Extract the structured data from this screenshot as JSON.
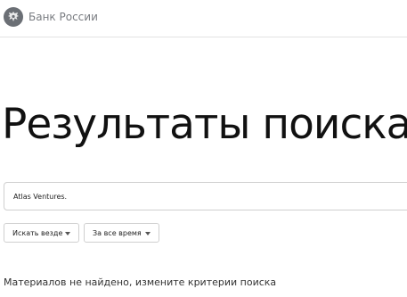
{
  "header": {
    "brand_name": "Банк России",
    "logo_icon": "double-headed-eagle-icon"
  },
  "main": {
    "title": "Результаты поиска",
    "search": {
      "value": "Atlas Ventures."
    },
    "filters": [
      {
        "label": "Искать везде",
        "icon": "chevron-down-icon"
      },
      {
        "label": "За все время",
        "icon": "chevron-down-icon"
      }
    ],
    "message": "Материалов не найдено, измените критерии поиска"
  }
}
